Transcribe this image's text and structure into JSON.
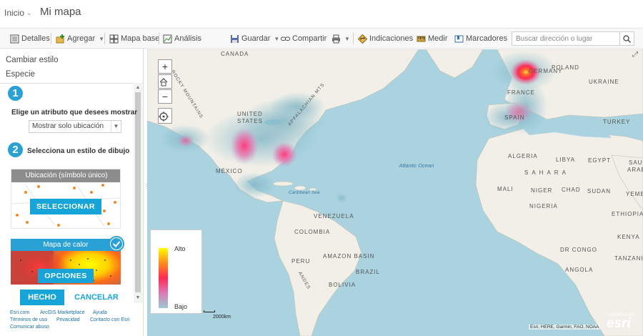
{
  "topbar": {
    "home_label": "Inicio",
    "map_title": "Mi mapa"
  },
  "toolbar": {
    "details": "Detalles",
    "add": "Agregar",
    "basemap": "Mapa base",
    "analysis": "Análisis",
    "save": "Guardar",
    "share": "Compartir",
    "directions": "Indicaciones",
    "measure": "Medir",
    "bookmarks": "Marcadores",
    "search_placeholder": "Buscar dirección o lugar"
  },
  "panel": {
    "change_style": "Cambiar estilo",
    "layer_name": "Especie",
    "step1_number": "1",
    "step1_text": "Elige un atributo que desees mostrar",
    "attribute_value": "Mostrar solo ubicación",
    "step2_number": "2",
    "step2_text": "Selecciona un estilo de dibujo",
    "style_location_title": "Ubicación (símbolo único)",
    "style_location_button": "SELECCIONAR",
    "style_heatmap_title": "Mapa de calor",
    "style_heatmap_button": "OPCIONES",
    "done": "HECHO",
    "cancel": "CANCELAR"
  },
  "footer": {
    "esri": "Esri.com",
    "marketplace": "ArcGIS Marketplace",
    "help": "Ayuda",
    "terms": "Términos de uso",
    "privacy": "Privacidad",
    "contact": "Contacto con Esri",
    "report": "Comunicar abuso"
  },
  "map": {
    "labels": {
      "canada": "CANADA",
      "rocky": "ROCKY MOUNTAINS",
      "united_states": "UNITED",
      "united_states2": "STATES",
      "appalachian": "APPALACHIAN MTS",
      "mexico": "MÉXICO",
      "caribbean": "Caribbean Sea",
      "venezuela": "VENEZUELA",
      "colombia": "COLOMBIA",
      "peru": "PERU",
      "amazon": "AMAZON BASIN",
      "brazil": "BRAZIL",
      "bolivia": "BOLIVIA",
      "andes": "ANDES",
      "atlantic": "Atlantic Ocean",
      "algeria": "ALGERIA",
      "libya": "LIBYA",
      "egypt": "EGYPT",
      "sahara": "SAHARA",
      "mali": "MALI",
      "niger": "NIGER",
      "chad": "CHAD",
      "sudan": "SUDAN",
      "nigeria": "NIGERIA",
      "angola": "ANGOLA",
      "dr_congo": "DR CONGO",
      "tanzania": "TANZANIA",
      "france": "FRANCE",
      "germany": "GERMANY",
      "poland": "POLAND",
      "ukraine": "UKRAINE",
      "spain": "SPAIN",
      "turkey": "TURKEY",
      "saudi": "SAUDI",
      "arabia": "ARABIA",
      "ethiopia": "ETHIOPIA",
      "kenya": "KENYA",
      "yemen": "YEMEN"
    },
    "legend_high": "Alto",
    "legend_low": "Bajo",
    "scale": "2000km",
    "attribution": "Esri, HERE, Garmin, FAO, NOAA",
    "logo_powered": "POWERED BY",
    "logo_name": "esri"
  },
  "colors": {
    "accent": "#17a5d9",
    "ocean": "#aad3df",
    "land": "#f1efe8",
    "heat_low": "#9cc9d4",
    "heat_high": "#ffff00"
  }
}
